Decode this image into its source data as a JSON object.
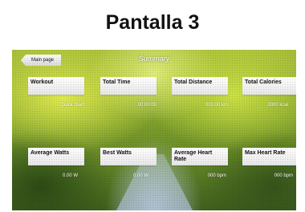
{
  "heading": "Pantalla 3",
  "screen": {
    "back_label": "Main page",
    "title": "Summary"
  },
  "stats": [
    {
      "label": "Workout",
      "value": "Quick Start"
    },
    {
      "label": "Total Time",
      "value": "00:00:00"
    },
    {
      "label": "Total Distance",
      "value": "000.00 km"
    },
    {
      "label": "Total Calories",
      "value": "0000 kcal"
    },
    {
      "label": "Average Watts",
      "value": "0.00 W"
    },
    {
      "label": "Best Watts",
      "value": "0.00 W"
    },
    {
      "label": "Average Heart Rate",
      "value": "000 bpm"
    },
    {
      "label": "Max Heart Rate",
      "value": "000 bpm"
    }
  ]
}
